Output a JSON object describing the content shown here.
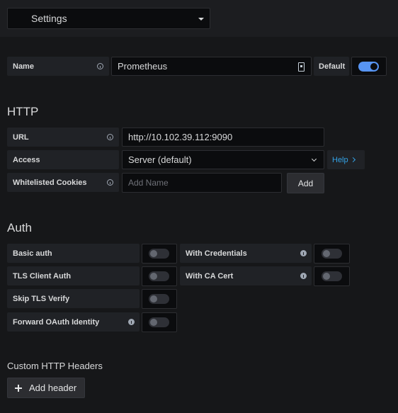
{
  "header": {
    "settings_label": "Settings"
  },
  "general": {
    "name_label": "Name",
    "name_value": "Prometheus",
    "default_label": "Default",
    "default_on": true
  },
  "http": {
    "title": "HTTP",
    "url_label": "URL",
    "url_value": "http://10.102.39.112:9090",
    "access_label": "Access",
    "access_value": "Server (default)",
    "help_label": "Help",
    "cookies_label": "Whitelisted Cookies",
    "cookies_placeholder": "Add Name",
    "add_label": "Add"
  },
  "auth": {
    "title": "Auth",
    "basic_auth": "Basic auth",
    "with_credentials": "With Credentials",
    "tls_client_auth": "TLS Client Auth",
    "with_ca_cert": "With CA Cert",
    "skip_tls_verify": "Skip TLS Verify",
    "forward_oauth": "Forward OAuth Identity"
  },
  "headers": {
    "title": "Custom HTTP Headers",
    "add_header_label": "Add header"
  },
  "colors": {
    "accent": "#5794f2",
    "link": "#33a2e5",
    "background": "#161719"
  }
}
